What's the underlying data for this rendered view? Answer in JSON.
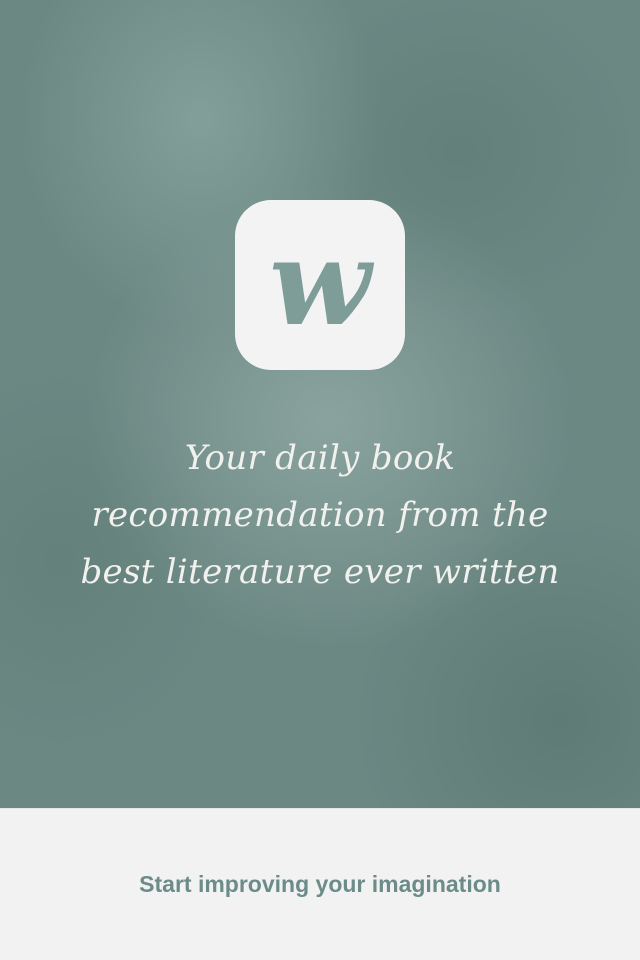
{
  "logo": {
    "letter": "w",
    "icon": "wattpad-w-logo-icon"
  },
  "tagline": {
    "lines": [
      "Your daily book",
      "recommendation from the",
      "best literature ever written"
    ]
  },
  "footer": {
    "cta_label": "Start improving your imagination"
  },
  "colors": {
    "hero_base": "#6c8883",
    "logo_tile": "#f3f3f3",
    "logo_letter": "#7e9c98",
    "tagline_text": "#f1f1ee",
    "footer_bg": "#f2f2f2",
    "cta_text": "#6b8c88"
  }
}
